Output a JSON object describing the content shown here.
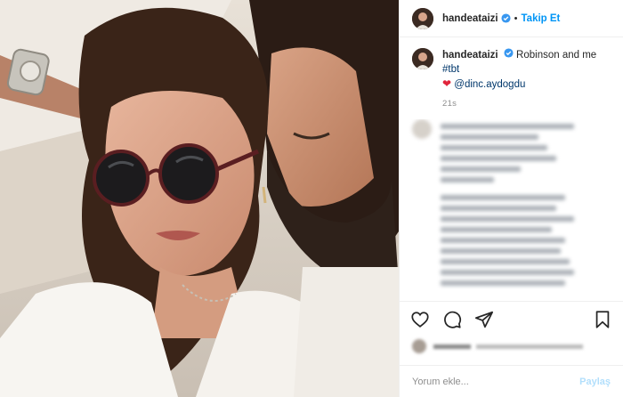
{
  "header": {
    "username": "handeataizi",
    "separator": "•",
    "follow_label": "Takip Et",
    "verified_icon": "verified-badge-icon"
  },
  "caption": {
    "username": "handeataizi",
    "text": "Robinson and me",
    "hashtag": "#tbt",
    "emoji": "❤",
    "mention": "@dinc.aydogdu",
    "time": "21s"
  },
  "actions": {
    "like_icon": "heart-icon",
    "comment_icon": "comment-icon",
    "share_icon": "paper-plane-icon",
    "save_icon": "bookmark-icon"
  },
  "add_comment": {
    "placeholder": "Yorum ekle...",
    "post_label": "Paylaş"
  },
  "colors": {
    "accent": "#0095f6",
    "link": "#00376b",
    "muted": "#8e8e8e",
    "post_disabled": "#b2dffc"
  }
}
